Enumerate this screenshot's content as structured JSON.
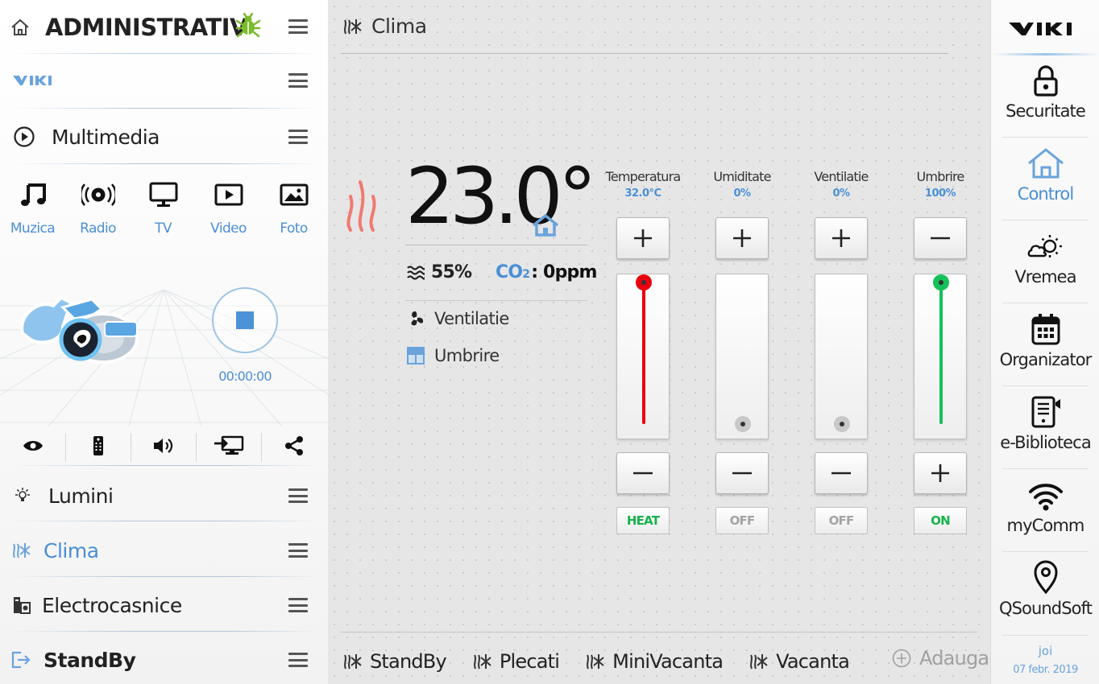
{
  "sidebar": {
    "title": "ADMINISTRATIV",
    "items": [
      {
        "label": "Multimedia"
      },
      {
        "label": "Lumini"
      },
      {
        "label": "Clima"
      },
      {
        "label": "Electrocasnice"
      },
      {
        "label": "StandBy"
      }
    ],
    "media": [
      {
        "label": "Muzica",
        "icon": "music-note-icon"
      },
      {
        "label": "Radio",
        "icon": "radio-icon"
      },
      {
        "label": "TV",
        "icon": "tv-icon"
      },
      {
        "label": "Video",
        "icon": "video-icon"
      },
      {
        "label": "Foto",
        "icon": "photo-icon"
      }
    ],
    "player": {
      "time": "00:00:00"
    },
    "accent": "#4a8fd6"
  },
  "climate": {
    "title": "Clima",
    "temperature": "23.0°",
    "humidity": "55%",
    "co2_label": "CO",
    "co2_sub": "2",
    "co2_value": ": 0ppm",
    "options": [
      "Ventilatie",
      "Umbrire"
    ],
    "controls": [
      {
        "title": "Temperatura",
        "value": "32.0°C",
        "status": "HEAT",
        "level": 1.0,
        "color": "#e8000e",
        "status_color": "#16b24b"
      },
      {
        "title": "Umiditate",
        "value": "0%",
        "status": "OFF",
        "level": 0.0,
        "color": "#b9b9b9",
        "status_color": "#a3a3a3"
      },
      {
        "title": "Ventilatie",
        "value": "0%",
        "status": "OFF",
        "level": 0.0,
        "color": "#dedede",
        "status_color": "#a3a3a3"
      },
      {
        "title": "Umbrire",
        "value": "100%",
        "status": "ON",
        "level": 1.0,
        "color": "#14c15a",
        "status_color": "#16b24b"
      }
    ],
    "scenes": [
      "StandBy",
      "Plecati",
      "MiniVacanta",
      "Vacanta"
    ],
    "add_label": "Adauga"
  },
  "rightnav": {
    "items": [
      {
        "label": "Securitate",
        "icon": "lock-icon"
      },
      {
        "label": "Control",
        "icon": "home-icon"
      },
      {
        "label": "Vremea",
        "icon": "weather-icon"
      },
      {
        "label": "Organizator",
        "icon": "calendar-icon"
      },
      {
        "label": "e-Biblioteca",
        "icon": "book-icon"
      },
      {
        "label": "myComm",
        "icon": "wifi-icon"
      },
      {
        "label": "QSoundSoft",
        "icon": "location-pin-icon"
      }
    ],
    "date_day": "joi",
    "date_full": "07 febr. 2019"
  }
}
